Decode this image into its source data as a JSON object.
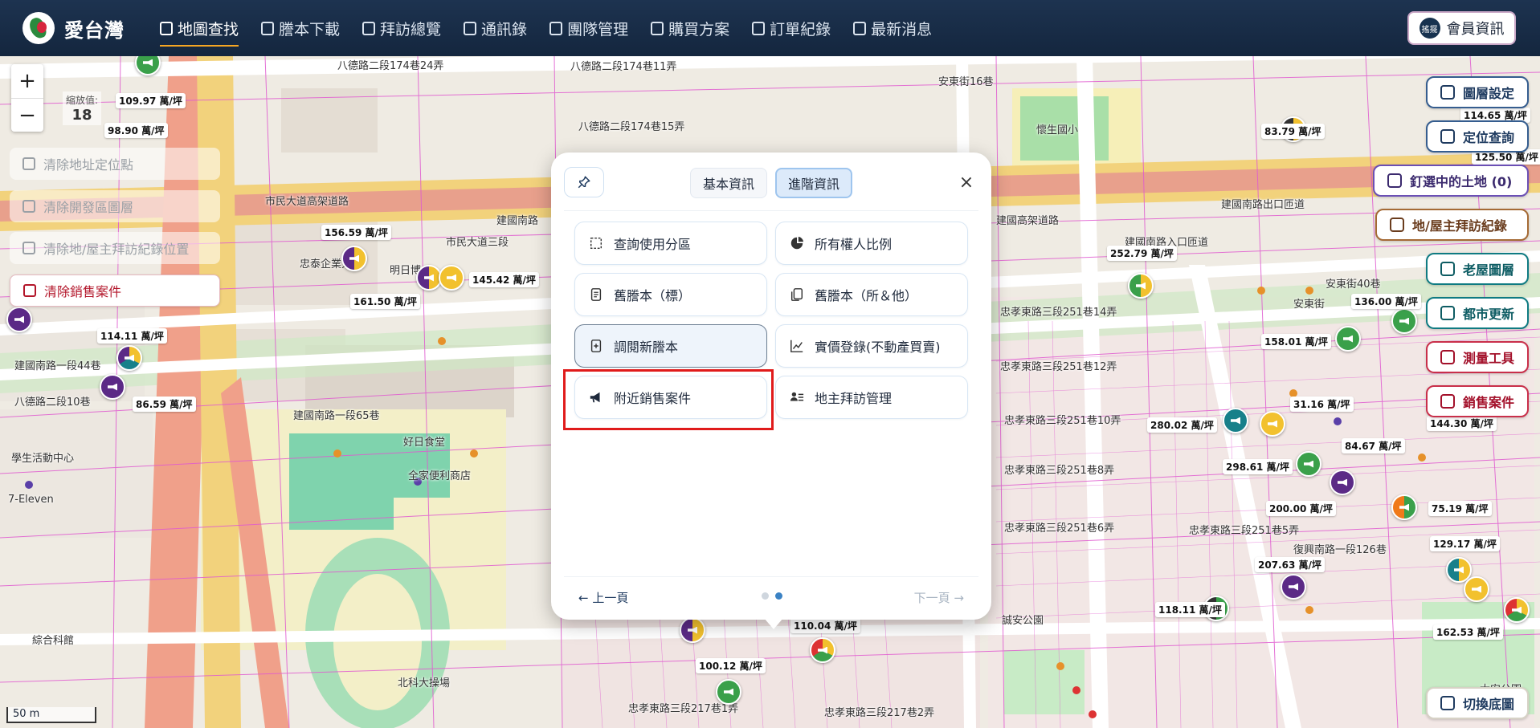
{
  "app": {
    "name": "愛台灣"
  },
  "nav": {
    "items": [
      {
        "label": "地圖查找",
        "icon": "map-icon",
        "active": true
      },
      {
        "label": "謄本下載",
        "icon": "document-icon",
        "active": false
      },
      {
        "label": "拜訪總覽",
        "icon": "chart-icon",
        "active": false
      },
      {
        "label": "通訊錄",
        "icon": "contact-card-icon",
        "active": false
      },
      {
        "label": "團隊管理",
        "icon": "team-icon",
        "active": false
      },
      {
        "label": "購買方案",
        "icon": "folder-icon",
        "active": false
      },
      {
        "label": "訂單紀錄",
        "icon": "receipt-icon",
        "active": false
      },
      {
        "label": "最新消息",
        "icon": "newspaper-icon",
        "active": false
      }
    ],
    "member_button": "會員資訊",
    "member_avatar": "搖擺"
  },
  "map": {
    "zoom_in": "+",
    "zoom_out": "−",
    "zoom_label": "縮放值:",
    "zoom_value": "18",
    "scale": "50 m",
    "left_buttons": [
      {
        "label": "清除地址定位點",
        "enabled": false
      },
      {
        "label": "清除開發區圖層",
        "enabled": false
      },
      {
        "label": "清除地/屋主拜訪紀錄位置",
        "enabled": false
      },
      {
        "label": "清除銷售案件",
        "enabled": true
      }
    ],
    "right_buttons": [
      {
        "label": "圖層設定"
      },
      {
        "label": "定位查詢"
      },
      {
        "label": "釘選中的土地 (0)"
      },
      {
        "label": "地/屋主拜訪紀錄"
      },
      {
        "label": "老屋圖層"
      },
      {
        "label": "都市更新"
      },
      {
        "label": "測量工具"
      },
      {
        "label": "銷售案件"
      },
      {
        "label": "切換底圖"
      }
    ],
    "streets": [
      "八德路二段174巷24弄",
      "八德路二段174巷11弄",
      "八德路二段174巷15弄",
      "市民大道高架道路",
      "市民大道三段",
      "建國南路",
      "建國南路一段44巷",
      "八德路二段10巷",
      "建國南路一段65巷",
      "建國南路出口匝道",
      "建國南路入口匝道",
      "建國高架道路",
      "忠孝東路三段251巷14弄",
      "忠孝東路三段251巷12弄",
      "忠孝東路三段251巷10弄",
      "忠孝東路三段251巷8弄",
      "忠孝東路三段251巷6弄",
      "忠孝東路三段251巷5弄",
      "忠孝東路三段217巷1弄",
      "忠孝東路三段217巷2弄",
      "復興南路一段126巷",
      "安東街",
      "安東街16巷",
      "安東街40巷",
      "懷生國小",
      "北科大操場",
      "學生活動中心",
      "綜合科館",
      "明日博",
      "忠泰企業大樓",
      "好日食堂",
      "全家便利商店",
      "7-Eleven",
      "誠安公園",
      "大安公園"
    ],
    "prices": [
      "109.97 萬/坪",
      "98.90 萬/坪",
      "156.59 萬/坪",
      "161.50 萬/坪",
      "145.42 萬/坪",
      "114.11 萬/坪",
      "86.59 萬/坪",
      "83.79 萬/坪",
      "114.65 萬/坪",
      "125.50 萬/坪",
      "252.79 萬/坪",
      "136.00 萬/坪",
      "158.01 萬/坪",
      "31.16 萬/坪",
      "280.02 萬/坪",
      "144.30 萬/坪",
      "84.67 萬/坪",
      "298.61 萬/坪",
      "200.00 萬/坪",
      "75.19 萬/坪",
      "129.17 萬/坪",
      "207.63 萬/坪",
      "118.11 萬/坪",
      "162.53 萬/坪",
      "110.04 萬/坪",
      "100.12 萬/坪"
    ]
  },
  "modal": {
    "tabs": [
      {
        "label": "基本資訊",
        "active": false
      },
      {
        "label": "進階資訊",
        "active": true
      }
    ],
    "close": "×",
    "options": [
      {
        "label": "查詢使用分區",
        "icon": "zoning-icon"
      },
      {
        "label": "所有權人比例",
        "icon": "pie-chart-icon"
      },
      {
        "label": "舊謄本（標）",
        "icon": "old-document-icon"
      },
      {
        "label": "舊謄本（所＆他）",
        "icon": "copy-document-icon"
      },
      {
        "label": "調閱新謄本",
        "icon": "add-document-icon"
      },
      {
        "label": "實價登錄(不動產買賣)",
        "icon": "trend-chart-icon"
      },
      {
        "label": "附近銷售案件",
        "icon": "megaphone-icon"
      },
      {
        "label": "地主拜訪管理",
        "icon": "visit-manage-icon"
      }
    ],
    "prev": "← 上一頁",
    "next": "下一頁 →"
  },
  "colors": {
    "nav_bg": "#17324f",
    "accent": "#f5a623",
    "highlight_red": "#e01b1b",
    "sale_red": "#b3162a",
    "teal": "#0f7b82",
    "purple": "#6b4fb5"
  }
}
